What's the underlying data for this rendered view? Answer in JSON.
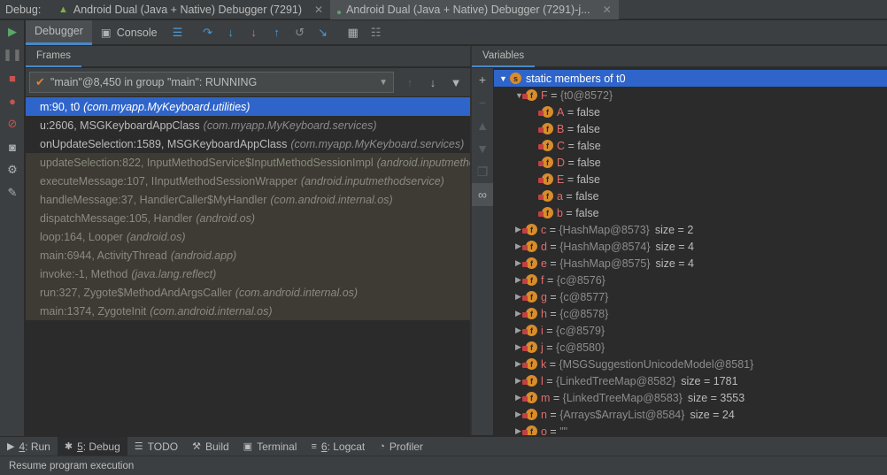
{
  "topbar": {
    "label": "Debug:",
    "tabs": [
      {
        "label": "Android Dual (Java + Native) Debugger (7291)",
        "active": false
      },
      {
        "label": "Android Dual (Java + Native) Debugger (7291)-j...",
        "active": true
      }
    ]
  },
  "toolbar": {
    "debugger_tab": "Debugger",
    "console_tab": "Console"
  },
  "frames": {
    "header": "Frames",
    "thread": "\"main\"@8,450 in group \"main\": RUNNING",
    "items": [
      {
        "method": "m:90, t0",
        "cls": "(com.myapp.MyKeyboard.utilities)",
        "kind": "selected"
      },
      {
        "method": "u:2606, MSGKeyboardAppClass",
        "cls": "(com.myapp.MyKeyboard.services)",
        "kind": "app"
      },
      {
        "method": "onUpdateSelection:1589, MSGKeyboardAppClass",
        "cls": "(com.myapp.MyKeyboard.services)",
        "kind": "app"
      },
      {
        "method": "updateSelection:822, InputMethodService$InputMethodSessionImpl",
        "cls": "(android.inputmethodservice)",
        "kind": "lib"
      },
      {
        "method": "executeMessage:107, IInputMethodSessionWrapper",
        "cls": "(android.inputmethodservice)",
        "kind": "lib"
      },
      {
        "method": "handleMessage:37, HandlerCaller$MyHandler",
        "cls": "(com.android.internal.os)",
        "kind": "lib"
      },
      {
        "method": "dispatchMessage:105, Handler",
        "cls": "(android.os)",
        "kind": "lib"
      },
      {
        "method": "loop:164, Looper",
        "cls": "(android.os)",
        "kind": "lib"
      },
      {
        "method": "main:6944, ActivityThread",
        "cls": "(android.app)",
        "kind": "lib"
      },
      {
        "method": "invoke:-1, Method",
        "cls": "(java.lang.reflect)",
        "kind": "lib"
      },
      {
        "method": "run:327, Zygote$MethodAndArgsCaller",
        "cls": "(com.android.internal.os)",
        "kind": "lib"
      },
      {
        "method": "main:1374, ZygoteInit",
        "cls": "(com.android.internal.os)",
        "kind": "lib"
      }
    ]
  },
  "variables": {
    "header": "Variables",
    "items": [
      {
        "depth": 0,
        "tri": "▼",
        "badge": "s",
        "name": "static members of t0",
        "eq": "",
        "ref": "",
        "size": "",
        "selected": true
      },
      {
        "depth": 1,
        "tri": "▼",
        "badge": "f",
        "name": "F",
        "eq": " = ",
        "ref": "{t0@8572}",
        "size": ""
      },
      {
        "depth": 2,
        "tri": "",
        "badge": "f",
        "name": "A",
        "eq": " = ",
        "val": "false",
        "ref": "",
        "size": ""
      },
      {
        "depth": 2,
        "tri": "",
        "badge": "f",
        "name": "B",
        "eq": " = ",
        "val": "false",
        "ref": "",
        "size": ""
      },
      {
        "depth": 2,
        "tri": "",
        "badge": "f",
        "name": "C",
        "eq": " = ",
        "val": "false",
        "ref": "",
        "size": ""
      },
      {
        "depth": 2,
        "tri": "",
        "badge": "f",
        "name": "D",
        "eq": " = ",
        "val": "false",
        "ref": "",
        "size": ""
      },
      {
        "depth": 2,
        "tri": "",
        "badge": "f",
        "name": "E",
        "eq": " = ",
        "val": "false",
        "ref": "",
        "size": ""
      },
      {
        "depth": 2,
        "tri": "",
        "badge": "f",
        "name": "a",
        "eq": " = ",
        "val": "false",
        "ref": "",
        "size": ""
      },
      {
        "depth": 2,
        "tri": "",
        "badge": "f",
        "name": "b",
        "eq": " = ",
        "val": "false",
        "ref": "",
        "size": ""
      },
      {
        "depth": 1,
        "tri": "▶",
        "badge": "f",
        "name": "c",
        "eq": " = ",
        "ref": "{HashMap@8573}",
        "size": "size = 2"
      },
      {
        "depth": 1,
        "tri": "▶",
        "badge": "f",
        "name": "d",
        "eq": " = ",
        "ref": "{HashMap@8574}",
        "size": "size = 4"
      },
      {
        "depth": 1,
        "tri": "▶",
        "badge": "f",
        "name": "e",
        "eq": " = ",
        "ref": "{HashMap@8575}",
        "size": "size = 4"
      },
      {
        "depth": 1,
        "tri": "▶",
        "badge": "f",
        "name": "f",
        "eq": " = ",
        "ref": "{c@8576}",
        "size": ""
      },
      {
        "depth": 1,
        "tri": "▶",
        "badge": "f",
        "name": "g",
        "eq": " = ",
        "ref": "{c@8577}",
        "size": ""
      },
      {
        "depth": 1,
        "tri": "▶",
        "badge": "f",
        "name": "h",
        "eq": " = ",
        "ref": "{c@8578}",
        "size": ""
      },
      {
        "depth": 1,
        "tri": "▶",
        "badge": "f",
        "name": "i",
        "eq": " = ",
        "ref": "{c@8579}",
        "size": ""
      },
      {
        "depth": 1,
        "tri": "▶",
        "badge": "f",
        "name": "j",
        "eq": " = ",
        "ref": "{c@8580}",
        "size": ""
      },
      {
        "depth": 1,
        "tri": "▶",
        "badge": "f",
        "name": "k",
        "eq": " = ",
        "ref": "{MSGSuggestionUnicodeModel@8581}",
        "size": ""
      },
      {
        "depth": 1,
        "tri": "▶",
        "badge": "f",
        "name": "l",
        "eq": " = ",
        "ref": "{LinkedTreeMap@8582}",
        "size": "size = 1781"
      },
      {
        "depth": 1,
        "tri": "▶",
        "badge": "f",
        "name": "m",
        "eq": " = ",
        "ref": "{LinkedTreeMap@8583}",
        "size": "size = 3553"
      },
      {
        "depth": 1,
        "tri": "▶",
        "badge": "f",
        "name": "n",
        "eq": " = ",
        "ref": "{Arrays$ArrayList@8584}",
        "size": "size = 24"
      },
      {
        "depth": 1,
        "tri": "▶",
        "badge": "f",
        "name": "o",
        "eq": " = ",
        "ref": "\"\"",
        "size": ""
      }
    ]
  },
  "bottom": {
    "tabs": [
      {
        "num": "4",
        "label": ": Run",
        "icon": "▶",
        "active": false
      },
      {
        "num": "5",
        "label": ": Debug",
        "icon": "✱",
        "active": true
      },
      {
        "num": "",
        "label": "TODO",
        "icon": "☰",
        "active": false
      },
      {
        "num": "",
        "label": "Build",
        "icon": "⚒",
        "active": false
      },
      {
        "num": "",
        "label": "Terminal",
        "icon": "▣",
        "active": false
      },
      {
        "num": "6",
        "label": ": Logcat",
        "icon": "≡",
        "active": false
      },
      {
        "num": "",
        "label": "Profiler",
        "icon": "◔",
        "active": false
      }
    ]
  },
  "status": "Resume program execution"
}
